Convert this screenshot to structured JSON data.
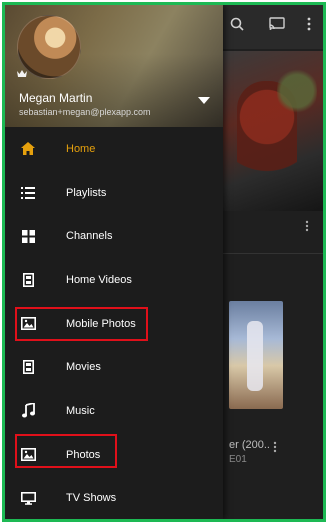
{
  "user": {
    "name": "Megan Martin",
    "email": "sebastian+megan@plexapp.com"
  },
  "menu": {
    "items": [
      {
        "label": "Home",
        "icon": "home-icon"
      },
      {
        "label": "Playlists",
        "icon": "list-icon"
      },
      {
        "label": "Channels",
        "icon": "grid-icon"
      },
      {
        "label": "Home Videos",
        "icon": "film-icon"
      },
      {
        "label": "Mobile Photos",
        "icon": "image-icon"
      },
      {
        "label": "Movies",
        "icon": "film-icon"
      },
      {
        "label": "Music",
        "icon": "music-note-icon"
      },
      {
        "label": "Photos",
        "icon": "image-icon"
      },
      {
        "label": "TV Shows",
        "icon": "monitor-icon"
      }
    ],
    "active": "Home"
  },
  "background": {
    "poster_title": "er (200..",
    "poster_subtitle": "E01"
  },
  "colors": {
    "accent": "#e5a00d",
    "highlight_border": "#e0101a",
    "frame_border": "#1db954",
    "drawer_bg": "#1c1c1c"
  }
}
